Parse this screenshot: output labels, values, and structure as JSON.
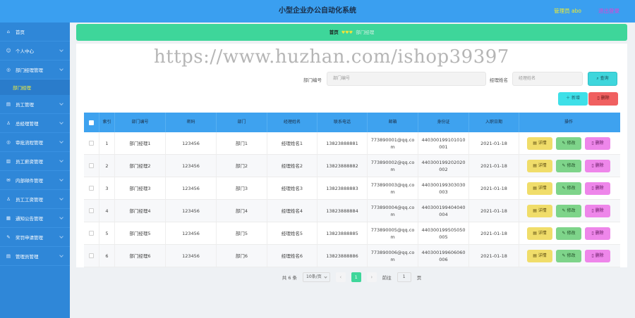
{
  "header": {
    "title": "小型企业办公自动化系统",
    "admin": "管理员 abo",
    "logout": "退出登录"
  },
  "sidebar": {
    "items": [
      {
        "label": "首页",
        "icon": "home-icon",
        "glyph": "⌂"
      },
      {
        "label": "个人中心",
        "icon": "user-icon",
        "glyph": "☺"
      },
      {
        "label": "部门经理管理",
        "icon": "manager-icon",
        "glyph": "◎"
      },
      {
        "label": "员工管理",
        "icon": "staff-icon",
        "glyph": "▤"
      },
      {
        "label": "总经理管理",
        "icon": "boss-icon",
        "glyph": "♙"
      },
      {
        "label": "审批流程管理",
        "icon": "approval-icon",
        "glyph": "◎"
      },
      {
        "label": "员工薪资管理",
        "icon": "salary-icon",
        "glyph": "▥"
      },
      {
        "label": "内部邮件管理",
        "icon": "mail-icon",
        "glyph": "✉"
      },
      {
        "label": "员工工资管理",
        "icon": "wage-icon",
        "glyph": "♙"
      },
      {
        "label": "通知公告管理",
        "icon": "notice-icon",
        "glyph": "▦"
      },
      {
        "label": "奖罚申请管理",
        "icon": "reward-icon",
        "glyph": "✎"
      },
      {
        "label": "管理员管理",
        "icon": "admin-icon",
        "glyph": "▤"
      }
    ],
    "sub_label": "部门经理"
  },
  "breadcrumb": {
    "home": "首页",
    "sep": "♥♥♥",
    "current": "部门经理"
  },
  "search": {
    "label_1": "部门编号",
    "placeholder_1": "部门编号",
    "label_2": "经理姓名",
    "placeholder_2": "经理姓名",
    "query_label": "查询"
  },
  "actions": {
    "add": "新增",
    "delete": "删除"
  },
  "watermark": "https://www.huzhan.com/ishop39397",
  "table": {
    "headers": [
      "索引",
      "部门编号",
      "密码",
      "部门",
      "经理姓名",
      "联系电话",
      "邮箱",
      "身份证",
      "入职日期",
      "操作"
    ],
    "rows": [
      {
        "idx": "1",
        "no": "部门经理1",
        "pw": "123456",
        "dept": "部门1",
        "name": "经理姓名1",
        "phone": "13823888881",
        "mail": "773890001@qq.com",
        "id": "440300199101010001",
        "date": "2021-01-18"
      },
      {
        "idx": "2",
        "no": "部门经理2",
        "pw": "123456",
        "dept": "部门2",
        "name": "经理姓名2",
        "phone": "13823888882",
        "mail": "773890002@qq.com",
        "id": "440300199202020002",
        "date": "2021-01-18"
      },
      {
        "idx": "3",
        "no": "部门经理3",
        "pw": "123456",
        "dept": "部门3",
        "name": "经理姓名3",
        "phone": "13823888883",
        "mail": "773890003@qq.com",
        "id": "440300199303030003",
        "date": "2021-01-18"
      },
      {
        "idx": "4",
        "no": "部门经理4",
        "pw": "123456",
        "dept": "部门4",
        "name": "经理姓名4",
        "phone": "13823888884",
        "mail": "773890004@qq.com",
        "id": "440300199404040004",
        "date": "2021-01-18"
      },
      {
        "idx": "5",
        "no": "部门经理5",
        "pw": "123456",
        "dept": "部门5",
        "name": "经理姓名5",
        "phone": "13823888885",
        "mail": "773890005@qq.com",
        "id": "440300199505050005",
        "date": "2021-01-18"
      },
      {
        "idx": "6",
        "no": "部门经理6",
        "pw": "123456",
        "dept": "部门6",
        "name": "经理姓名6",
        "phone": "13823888886",
        "mail": "773890006@qq.com",
        "id": "440300199606060006",
        "date": "2021-01-18"
      }
    ],
    "ops": {
      "detail": "详情",
      "edit": "修改",
      "delete": "删除"
    }
  },
  "pager": {
    "total": "共 6 条",
    "size": "10条/页",
    "prev": "‹",
    "page": "1",
    "next": "›",
    "goto": "前往",
    "goto_value": "1",
    "page_unit": "页"
  },
  "colors": {
    "topbar": "#3a9ff0",
    "sidebar": "#2f87d8",
    "breadcrumb": "#3ed69a",
    "table_header": "#3ea2ef"
  }
}
